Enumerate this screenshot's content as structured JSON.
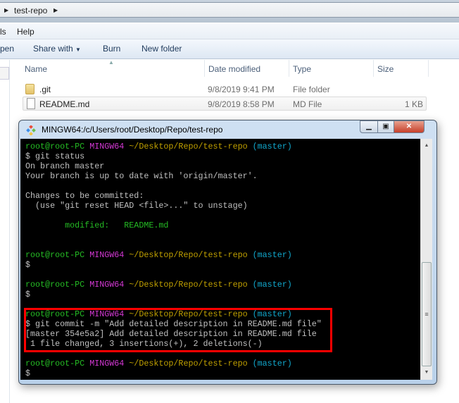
{
  "breadcrumb": {
    "current": "test-repo"
  },
  "menu": {
    "tools_partial": "ls",
    "help": "Help"
  },
  "toolbar": {
    "open_partial": "pen",
    "share_with": "Share with",
    "burn": "Burn",
    "new_folder": "New folder"
  },
  "columns": {
    "name": "Name",
    "date": "Date modified",
    "type": "Type",
    "size": "Size"
  },
  "files": [
    {
      "name": ".git",
      "date": "9/8/2019 9:41 PM",
      "type": "File folder",
      "size": ""
    },
    {
      "name": "README.md",
      "date": "9/8/2019 8:58 PM",
      "type": "MD File",
      "size": "1 KB"
    }
  ],
  "terminal": {
    "title": "MINGW64:/c/Users/root/Desktop/Repo/test-repo",
    "colors": {
      "green": "#25bc24",
      "magenta": "#d338d3",
      "yellow": "#c0a000",
      "cyan": "#11a8cd",
      "default": "#c0c0c0"
    },
    "lines": [
      [
        [
          "root@root-PC ",
          "green"
        ],
        [
          "MINGW64 ",
          "magenta"
        ],
        [
          "~/Desktop/Repo/test-repo ",
          "yellow"
        ],
        [
          "(master)",
          "cyan"
        ]
      ],
      [
        [
          "$ git status",
          "default"
        ]
      ],
      [
        [
          "On branch master",
          "default"
        ]
      ],
      [
        [
          "Your branch is up to date with 'origin/master'.",
          "default"
        ]
      ],
      [],
      [
        [
          "Changes to be committed:",
          "default"
        ]
      ],
      [
        [
          "  (use \"git reset HEAD <file>...\" to unstage)",
          "default"
        ]
      ],
      [],
      [
        [
          "        modified:   README.md",
          "green"
        ]
      ],
      [],
      [],
      [
        [
          "root@root-PC ",
          "green"
        ],
        [
          "MINGW64 ",
          "magenta"
        ],
        [
          "~/Desktop/Repo/test-repo ",
          "yellow"
        ],
        [
          "(master)",
          "cyan"
        ]
      ],
      [
        [
          "$",
          "default"
        ]
      ],
      [],
      [
        [
          "root@root-PC ",
          "green"
        ],
        [
          "MINGW64 ",
          "magenta"
        ],
        [
          "~/Desktop/Repo/test-repo ",
          "yellow"
        ],
        [
          "(master)",
          "cyan"
        ]
      ],
      [
        [
          "$",
          "default"
        ]
      ],
      [],
      [
        [
          "root@root-PC ",
          "green"
        ],
        [
          "MINGW64 ",
          "magenta"
        ],
        [
          "~/Desktop/Repo/test-repo ",
          "yellow"
        ],
        [
          "(master)",
          "cyan"
        ]
      ],
      [
        [
          "$ git commit -m \"Add detailed description in README.md file\"",
          "default"
        ]
      ],
      [
        [
          "[master 354e5a2] Add detailed description in README.md file",
          "default"
        ]
      ],
      [
        [
          " 1 file changed, 3 insertions(+), 2 deletions(-)",
          "default"
        ]
      ],
      [],
      [
        [
          "root@root-PC ",
          "green"
        ],
        [
          "MINGW64 ",
          "magenta"
        ],
        [
          "~/Desktop/Repo/test-repo ",
          "yellow"
        ],
        [
          "(master)",
          "cyan"
        ]
      ],
      [
        [
          "$",
          "default"
        ]
      ]
    ]
  }
}
